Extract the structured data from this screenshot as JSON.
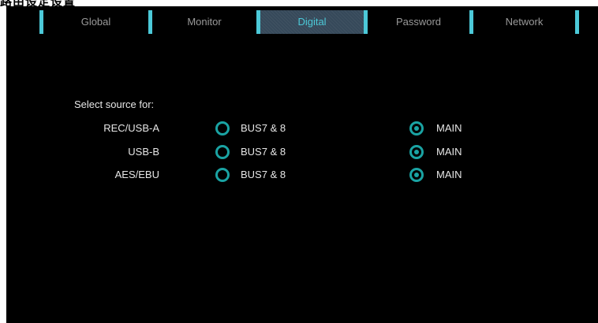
{
  "top_strip_text": "路由设定设置",
  "tabs": [
    {
      "label": "Global",
      "active": false
    },
    {
      "label": "Monitor",
      "active": false
    },
    {
      "label": "Digital",
      "active": true
    },
    {
      "label": "Password",
      "active": false
    },
    {
      "label": "Network",
      "active": false
    }
  ],
  "source": {
    "heading": "Select source for:",
    "option_a": "BUS7 & 8",
    "option_b": "MAIN",
    "rows": [
      {
        "label": "REC/USB-A",
        "selected": "MAIN"
      },
      {
        "label": "USB-B",
        "selected": "MAIN"
      },
      {
        "label": "AES/EBU",
        "selected": "MAIN"
      }
    ]
  },
  "colors": {
    "accent": "#4cc9d8",
    "radio": "#1aa3a3",
    "active_tab_bg": "#36495a",
    "text": "#e6e6e6",
    "inactive_tab_text": "#9a9a9a",
    "background": "#000000"
  }
}
